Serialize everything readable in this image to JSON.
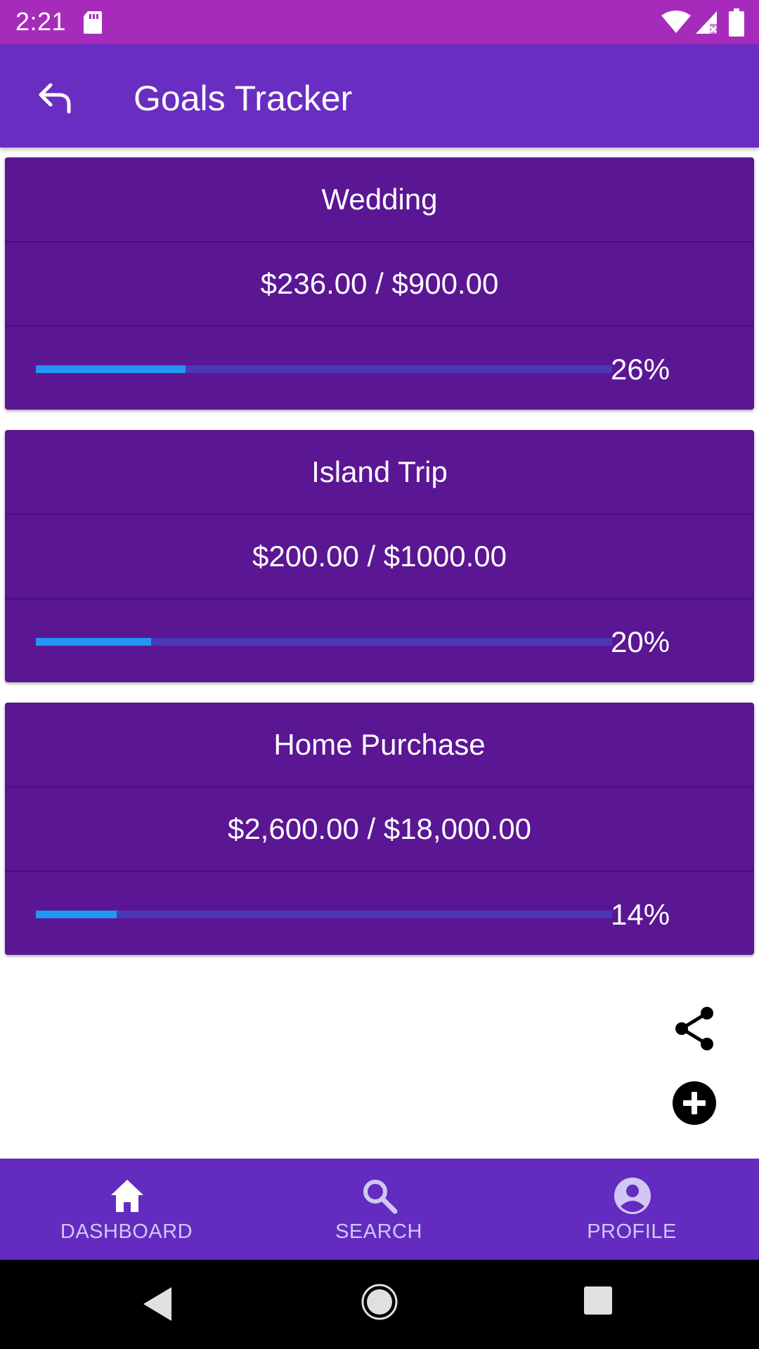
{
  "status_bar": {
    "time": "2:21",
    "icons": [
      "sd-card-icon",
      "wifi-icon",
      "signal-icon",
      "battery-icon"
    ]
  },
  "app_bar": {
    "title": "Goals Tracker",
    "back_icon": "back-arrow-icon"
  },
  "goals": [
    {
      "name": "Wedding",
      "amount": "$236.00 / $900.00",
      "percent_label": "26%",
      "progress": 0.26
    },
    {
      "name": "Island Trip",
      "amount": "$200.00 / $1000.00",
      "percent_label": "20%",
      "progress": 0.2
    },
    {
      "name": "Home Purchase",
      "amount": "$2,600.00 / $18,000.00",
      "percent_label": "14%",
      "progress": 0.14
    }
  ],
  "actions": {
    "share_icon": "share-icon",
    "add_icon": "add-circle-icon"
  },
  "bottom_nav": {
    "items": [
      {
        "label": "DASHBOARD",
        "icon": "home-icon"
      },
      {
        "label": "SEARCH",
        "icon": "search-icon"
      },
      {
        "label": "PROFILE",
        "icon": "account-circle-icon"
      }
    ]
  },
  "colors": {
    "status_bar": "#a72bba",
    "app_bar": "#692dc1",
    "card": "#5b1693",
    "progress_fill": "#2196f3",
    "progress_track": "#4a38b6",
    "bottom_nav": "#632bc0"
  }
}
